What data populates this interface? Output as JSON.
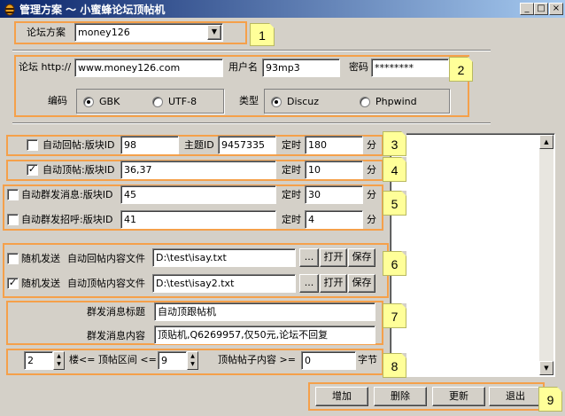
{
  "window": {
    "title": "管理方案 ～ 小蜜蜂论坛顶帖机",
    "controls": {
      "minimize": "_",
      "maximize": "□",
      "close": "×"
    }
  },
  "scheme": {
    "label": "论坛方案",
    "value": "money126",
    "marker": "1"
  },
  "forum": {
    "url_label": "论坛 http://",
    "url_value": "www.money126.com",
    "user_label": "用户名",
    "user_value": "93mp3",
    "password_label": "密码",
    "password_value": "********",
    "encoding_label": "编码",
    "encoding_options": [
      "GBK",
      "UTF-8"
    ],
    "encoding_selected": "GBK",
    "type_label": "类型",
    "type_options": [
      "Discuz",
      "Phpwind"
    ],
    "type_selected": "Discuz",
    "marker": "2"
  },
  "auto_reply": {
    "checkbox_label": "自动回帖:版块ID",
    "checked": false,
    "board_id": "98",
    "topic_label": "主题ID",
    "topic_id": "9457335",
    "timer_label": "定时",
    "timer_value": "180",
    "unit": "分",
    "marker": "3"
  },
  "auto_bump": {
    "checkbox_label": "自动顶帖:版块ID",
    "checked": true,
    "board_id": "36,37",
    "timer_label": "定时",
    "timer_value": "10",
    "unit": "分",
    "marker": "4"
  },
  "mass_msg": {
    "checkbox_label": "自动群发消息:版块ID",
    "checked": false,
    "board_id": "45",
    "timer_label": "定时",
    "timer_value": "30",
    "unit": "分"
  },
  "mass_greet": {
    "checkbox_label": "自动群发招呼:版块ID",
    "checked": false,
    "board_id": "41",
    "timer_label": "定时",
    "timer_value": "4",
    "unit": "分",
    "marker": "5"
  },
  "random_reply": {
    "checkbox_label": "随机发送",
    "checked": false,
    "file_label": "自动回帖内容文件",
    "file_value": "D:\\test\\isay.txt",
    "browse": "...",
    "open": "打开",
    "save": "保存"
  },
  "random_bump": {
    "checkbox_label": "随机发送",
    "checked": true,
    "file_label": "自动顶帖内容文件",
    "file_value": "D:\\test\\isay2.txt",
    "browse": "...",
    "open": "打开",
    "save": "保存",
    "marker": "6"
  },
  "message": {
    "title_label": "群发消息标题",
    "title_value": "自动顶跟帖机",
    "content_label": "群发消息内容",
    "content_value": "顶贴机,Q6269957,仅50元,论坛不回复",
    "marker": "7"
  },
  "range": {
    "from_value": "2",
    "mid_label": "楼<= 顶帖区间 <=",
    "to_value": "9",
    "content_label": "顶帖帖子内容 >=",
    "content_value": "0",
    "unit": "字节",
    "marker": "8"
  },
  "actions": {
    "add": "增加",
    "delete": "删除",
    "update": "更新",
    "exit": "退出",
    "marker": "9"
  }
}
